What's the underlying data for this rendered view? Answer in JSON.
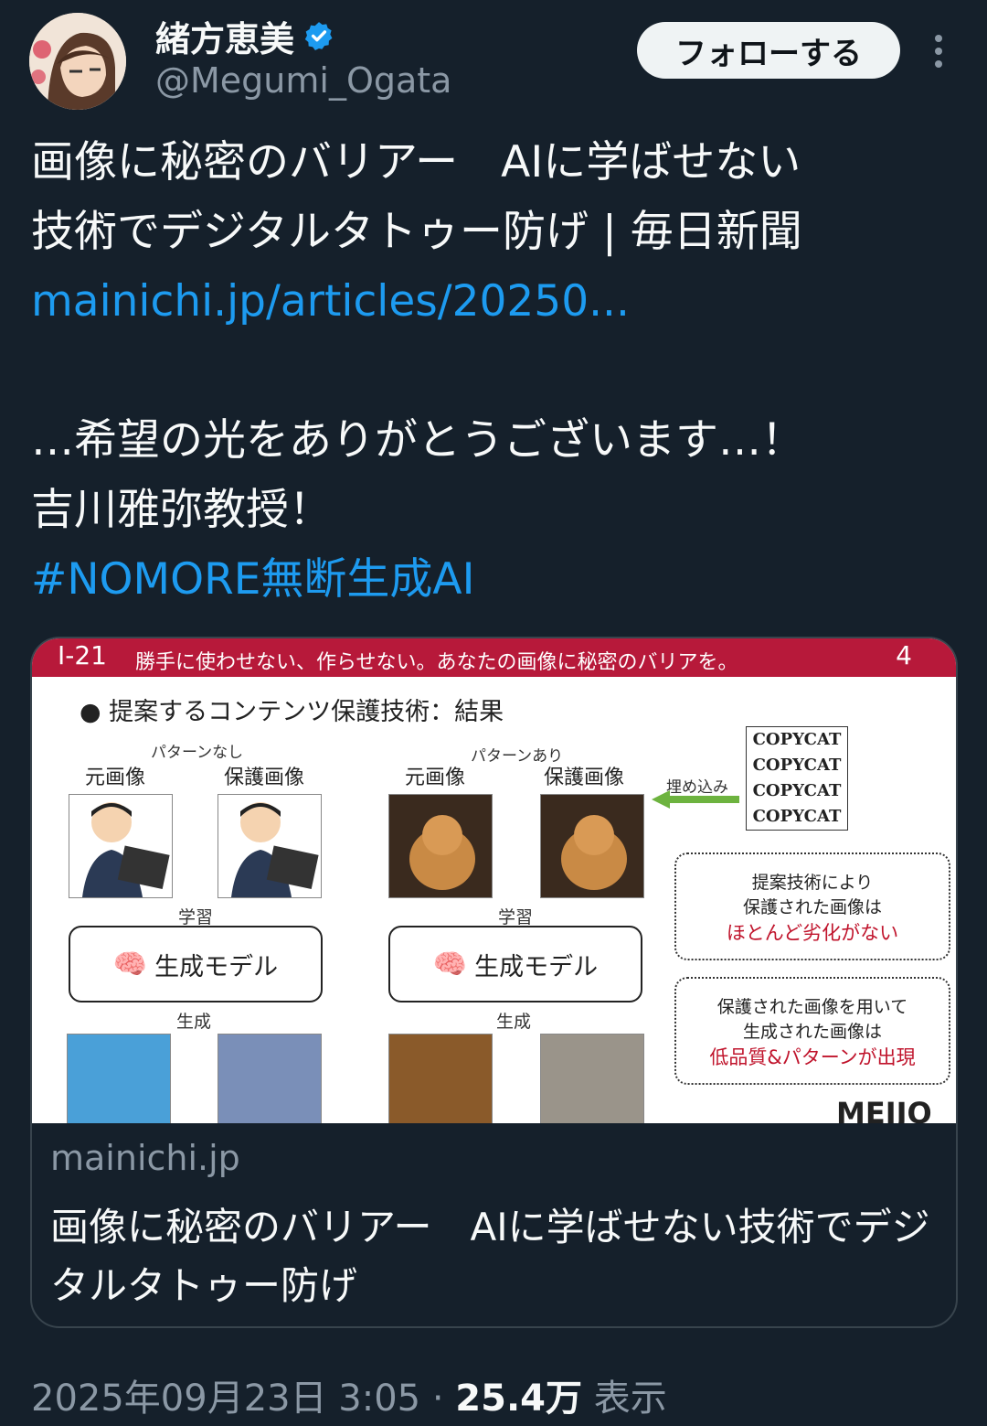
{
  "author": {
    "display_name": "緒方恵美",
    "handle": "@Megumi_Ogata",
    "verified": true
  },
  "follow_label": "フォローする",
  "tweet": {
    "line1": "画像に秘密のバリアー　AIに学ばせない",
    "line2": "技術でデジタルタトゥー防げ | 毎日新聞",
    "link": "mainichi.jp/articles/20250...",
    "line4": "…希望の光をありがとうございます…！",
    "line5": "吉川雅弥教授！",
    "hashtag": "#NOMORE無断生成AI"
  },
  "card": {
    "slide": {
      "id": "I-21",
      "title": "勝手に使わせない、作らせない。あなたの画像に秘密のバリアを。",
      "page": "4",
      "bullet": "● 提案するコンテンツ保護技術：結果",
      "left_caption": "パターンなし",
      "right_caption": "パターンあり",
      "original": "元画像",
      "protected": "保護画像",
      "learning": "学習",
      "model": "生成モデル",
      "generation": "生成",
      "embed": "埋め込み",
      "copycat": [
        "COPYCAT",
        "COPYCAT",
        "COPYCAT",
        "COPYCAT"
      ],
      "note1": [
        "提案技術により",
        "保護された画像は",
        "ほとんど劣化がない"
      ],
      "note2": [
        "保護された画像を用いて",
        "生成された画像は",
        "低品質&パターンが出現"
      ],
      "logo": "MEIJO"
    },
    "domain": "mainichi.jp",
    "title": "画像に秘密のバリアー　AIに学ばせない技術でデジタルタトゥー防げ"
  },
  "footer": {
    "datetime": "2025年09月23日 3:05",
    "sep": " · ",
    "views": "25.4万",
    "views_label": " 表示"
  },
  "colors": {
    "background": "#15202b",
    "link": "#1d9bf0",
    "verified": "#1d9bf0",
    "slide_header": "#b7193a",
    "secondary_text": "#8b98a5"
  }
}
